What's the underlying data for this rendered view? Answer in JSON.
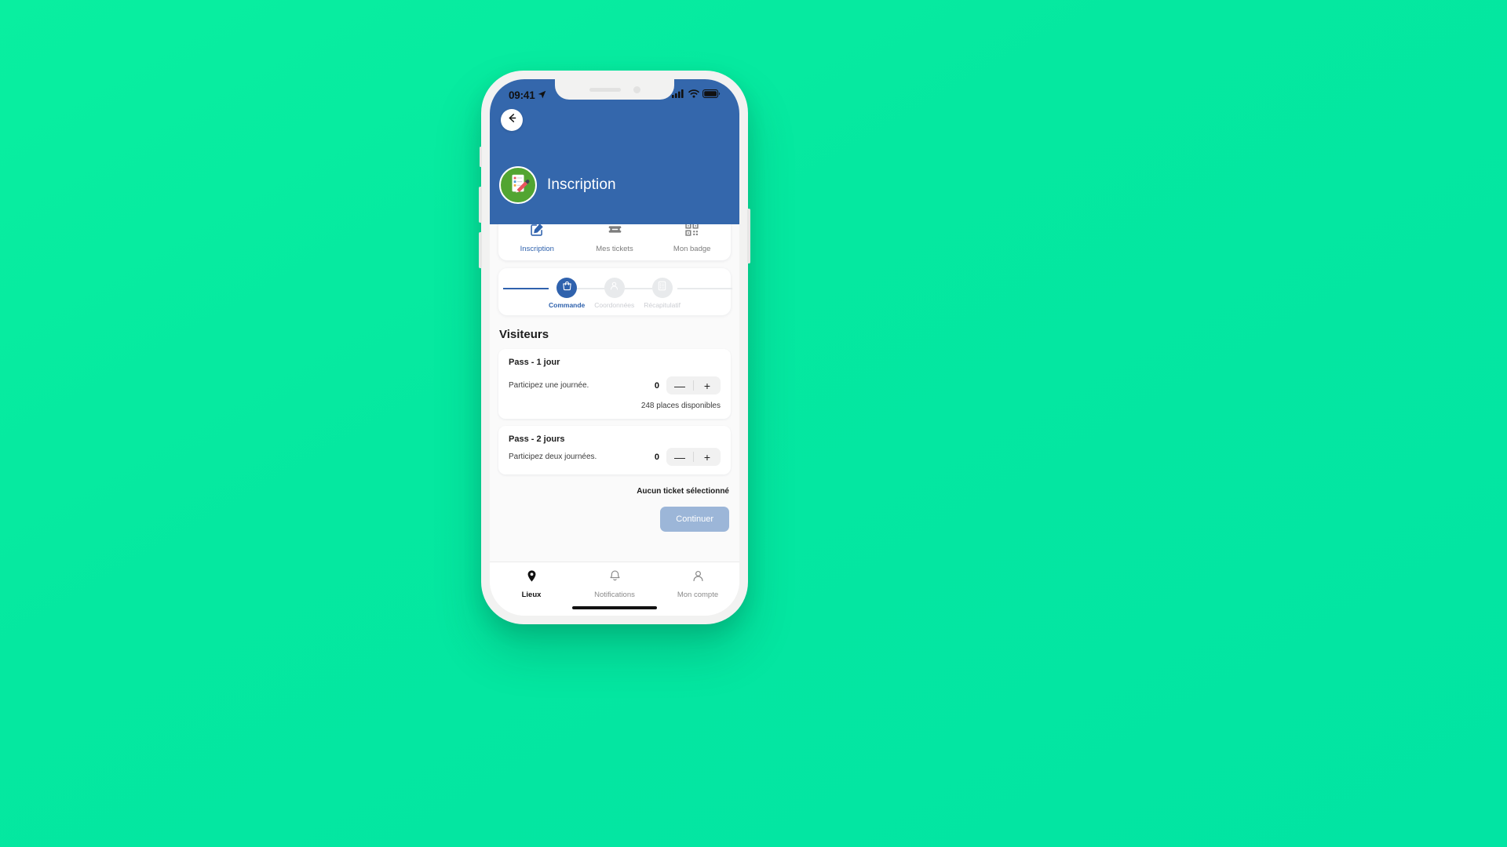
{
  "status_bar": {
    "time": "09:41",
    "location_icon": "location-arrow-icon",
    "signal_icon": "cellular-signal-icon",
    "wifi_icon": "wifi-icon",
    "battery_icon": "battery-full-icon"
  },
  "header": {
    "back_icon": "arrow-left-icon",
    "logo_icon": "clipboard-pencil-icon",
    "title": "Inscription",
    "background_color": "#3467ac",
    "logo_color": "#52a532"
  },
  "tabs": [
    {
      "label": "Inscription",
      "icon": "edit-square-icon",
      "active": true
    },
    {
      "label": "Mes tickets",
      "icon": "ticket-icon",
      "active": false
    },
    {
      "label": "Mon badge",
      "icon": "qr-code-icon",
      "active": false
    }
  ],
  "stepper": {
    "steps": [
      {
        "label": "Commande",
        "icon": "shopping-bag-icon",
        "active": true
      },
      {
        "label": "Coordonnées",
        "icon": "person-icon",
        "active": false
      },
      {
        "label": "Récapitulatif",
        "icon": "checklist-icon",
        "active": false
      }
    ],
    "active_color": "#2f62ad",
    "inactive_color": "#e8eaec"
  },
  "main": {
    "section_title": "Visiteurs",
    "tickets": [
      {
        "name": "Pass - 1 jour",
        "description": "Participez une journée.",
        "quantity": "0",
        "decrement_label": "—",
        "increment_label": "+",
        "availability": "248 places disponibles"
      },
      {
        "name": "Pass - 2 jours",
        "description": "Participez deux journées.",
        "quantity": "0",
        "decrement_label": "—",
        "increment_label": "+",
        "availability": ""
      }
    ],
    "summary": "Aucun ticket sélectionné",
    "continue_label": "Continuer",
    "continue_color": "#9cb6d8"
  },
  "bottom_nav": [
    {
      "label": "Lieux",
      "icon": "location-pin-icon",
      "active": true
    },
    {
      "label": "Notifications",
      "icon": "bell-icon",
      "active": false
    },
    {
      "label": "Mon compte",
      "icon": "person-outline-icon",
      "active": false
    }
  ]
}
